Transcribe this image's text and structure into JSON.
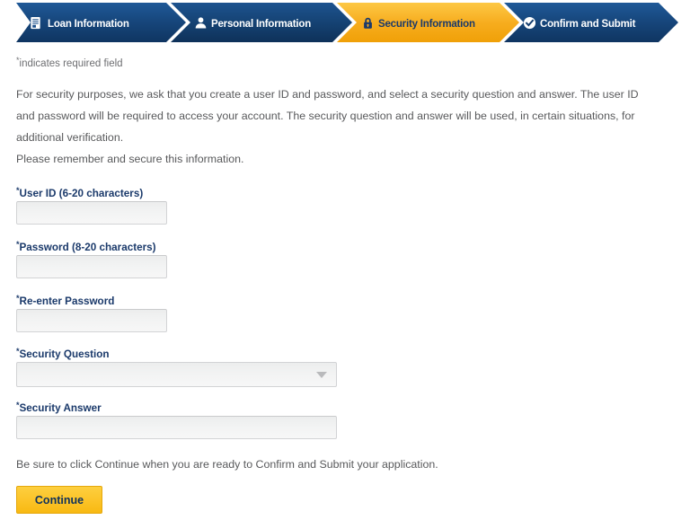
{
  "progress": {
    "steps": [
      {
        "label": "Loan Information",
        "icon": "document-icon",
        "state": "completed"
      },
      {
        "label": "Personal Information",
        "icon": "person-icon",
        "state": "completed"
      },
      {
        "label": "Security Information",
        "icon": "lock-icon",
        "state": "active"
      },
      {
        "label": "Confirm and Submit",
        "icon": "check-circle-icon",
        "state": "upcoming"
      }
    ],
    "colors": {
      "inactive_fill": "#1b4f8a",
      "inactive_fill_dark": "#123c6e",
      "active_fill": "#f5a623",
      "active_fill_light": "#fcc43a",
      "inactive_text": "#ffffff",
      "active_text": "#1b3a6b"
    }
  },
  "page": {
    "required_note": "indicates required field",
    "asterisk": "*",
    "intro_paragraph": "For security purposes, we ask that you create a user ID and password, and select a security question and answer. The user ID and password will be required to access your account. The security question and answer will be used, in certain situations, for additional verification.",
    "secure_note": "Please remember and secure this information.",
    "footer_note": "Be sure to click Continue when you are ready to Confirm and Submit your application."
  },
  "form": {
    "fields": [
      {
        "label": "User ID (6-20 characters)",
        "value": "",
        "placeholder": "",
        "type": "text"
      },
      {
        "label": "Password (8-20 characters)",
        "value": "",
        "placeholder": "",
        "type": "password"
      },
      {
        "label": "Re-enter Password",
        "value": "",
        "placeholder": "",
        "type": "password"
      },
      {
        "label": "Security Question",
        "value": "",
        "placeholder": "",
        "type": "select"
      },
      {
        "label": "Security Answer",
        "value": "",
        "placeholder": "",
        "type": "text"
      }
    ],
    "security_question_selected": ""
  },
  "actions": {
    "continue_label": "Continue"
  }
}
